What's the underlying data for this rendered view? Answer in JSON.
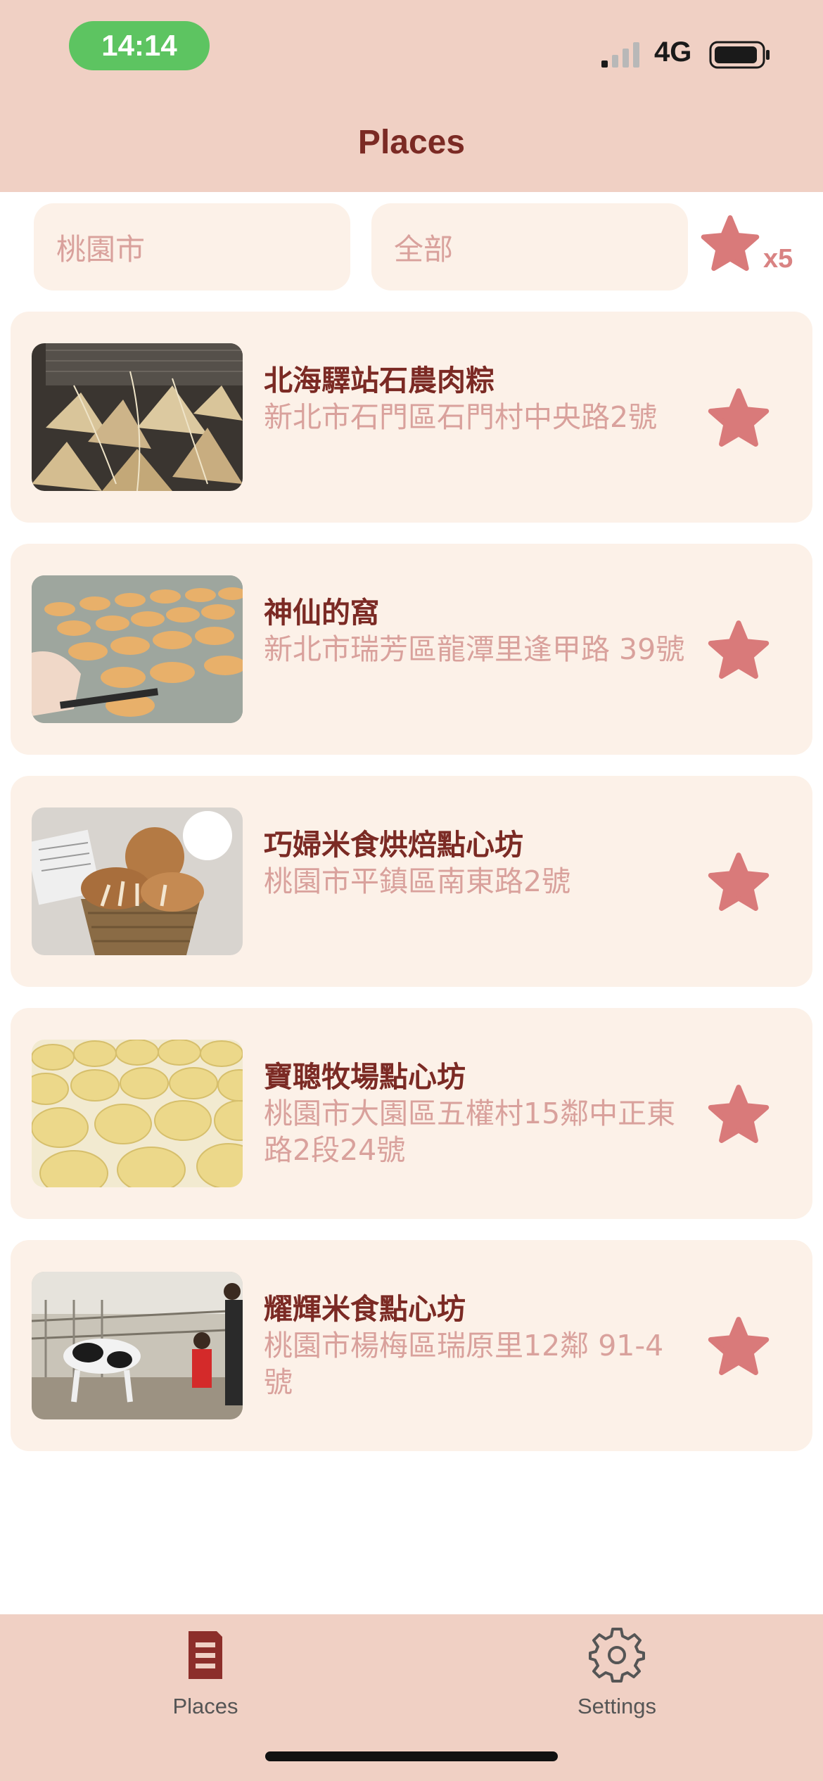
{
  "status_bar": {
    "time": "14:14",
    "network": "4G"
  },
  "nav": {
    "title": "Places"
  },
  "filters": {
    "city": "桃園市",
    "category": "全部",
    "favorites_count": "x5"
  },
  "places": [
    {
      "name": "北海驛站石農肉粽",
      "address": "新北市石門區石門村中央路2號",
      "favorited": true
    },
    {
      "name": "神仙的窩",
      "address": "新北市瑞芳區龍潭里逢甲路 39號",
      "favorited": true
    },
    {
      "name": "巧婦米食烘焙點心坊",
      "address": "桃園市平鎮區南東路2號",
      "favorited": true
    },
    {
      "name": "寶聰牧場點心坊",
      "address": "桃園市大園區五權村15鄰中正東路2段24號",
      "favorited": true
    },
    {
      "name": "耀輝米食點心坊",
      "address": "桃園市楊梅區瑞原里12鄰 91-4號",
      "favorited": true
    }
  ],
  "tabs": [
    {
      "label": "Places",
      "icon": "list-icon",
      "active": true
    },
    {
      "label": "Settings",
      "icon": "gear-icon",
      "active": false
    }
  ],
  "colors": {
    "header_bg": "#f0d0c4",
    "card_bg": "#fcf1e8",
    "title": "#7b2a24",
    "accent_star": "#d97a7a",
    "muted_text": "#d9a19c"
  }
}
